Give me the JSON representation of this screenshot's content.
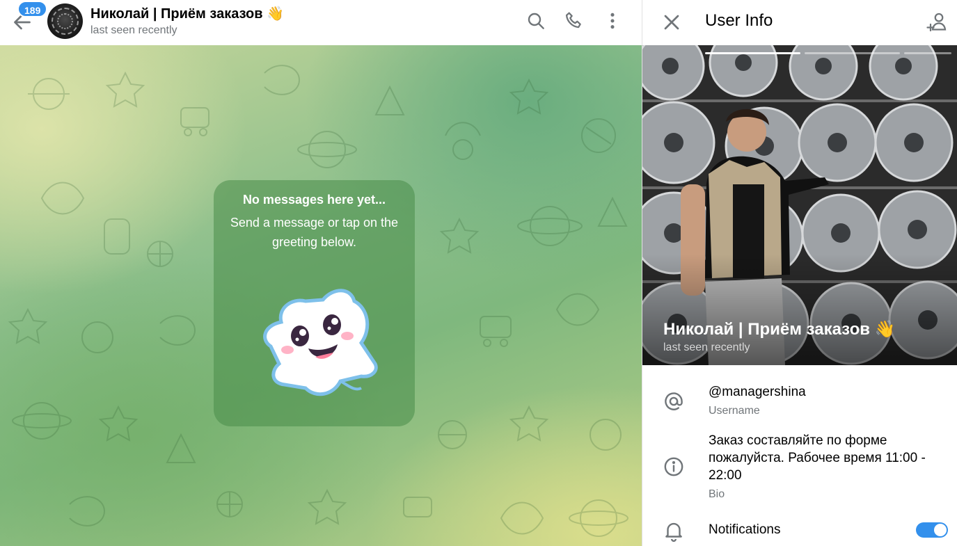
{
  "chat": {
    "unread_count": "189",
    "title": "Николай | Приём заказов 👋",
    "status": "last seen recently",
    "empty_state": {
      "title": "No messages here yet...",
      "text": "Send a message or tap on the greeting below."
    }
  },
  "info": {
    "title": "User Info",
    "name": "Николай | Приём заказов 👋",
    "status": "last seen recently",
    "username": "@managershina",
    "username_label": "Username",
    "bio": "Заказ составляйте по форме пожалуйста. Рабочее время 11:00 - 22:00",
    "bio_label": "Bio",
    "notifications_label": "Notifications",
    "notifications_on": true,
    "photo_count": 3,
    "photo_index": 1
  },
  "colors": {
    "accent": "#3390ec",
    "icon_gray": "#707579",
    "bubble_green": "#488c48"
  },
  "icons": {
    "back": "arrow-left-icon",
    "search": "search-icon",
    "call": "phone-icon",
    "more": "more-vertical-icon",
    "close": "close-icon",
    "add_contact": "add-user-icon",
    "username": "at-sign-icon",
    "bio": "info-icon",
    "notifications": "bell-icon"
  }
}
